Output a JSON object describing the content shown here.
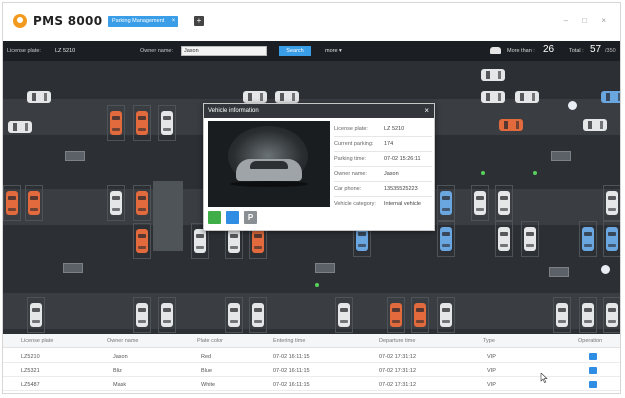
{
  "app": {
    "name": "PMS 8000"
  },
  "tabs": [
    {
      "label": "Parking Management",
      "close": "×"
    }
  ],
  "tab_add": "+",
  "window_controls": "– □ ×",
  "filter": {
    "plate_label": "License plate:",
    "plate_value": "LZ 5210",
    "owner_label": "Owner name:",
    "owner_value": "Jason",
    "search_label": "Search",
    "more_label": "more ▾",
    "more_than_label": "More than :",
    "more_than_value": "26",
    "total_label": "Total :",
    "total_value": "57",
    "total_capacity": "/350"
  },
  "popup": {
    "title": "Vehicle information",
    "close": "×",
    "fields": [
      {
        "label": "License plate:",
        "value": "LZ 5210"
      },
      {
        "label": "Current parking:",
        "value": "174"
      },
      {
        "label": "Parking time:",
        "value": "07-02  15:26:11"
      },
      {
        "label": "Owner name:",
        "value": "Jason"
      },
      {
        "label": "Car phone:",
        "value": "13535525223"
      },
      {
        "label": "Vehicle category:",
        "value": "Internal vehicle"
      }
    ],
    "buttons": [
      {
        "label": ""
      },
      {
        "label": ""
      },
      {
        "label": "P"
      }
    ]
  },
  "table": {
    "columns": [
      "License plate",
      "Owner name",
      "Plate color",
      "Entering time",
      "Departure time",
      "Type",
      "Operation"
    ],
    "rows": [
      [
        "LZ5210",
        "Jason",
        "Red",
        "07-02  16:11:15",
        "07-02  17:31:12",
        "VIP"
      ],
      [
        "LZ5321",
        "Bliz",
        "Blue",
        "07-02  16:11:15",
        "07-02  17:31:12",
        "VIP"
      ],
      [
        "LZ5487",
        "Mask",
        "White",
        "07-02  16:11:15",
        "07-02  17:31:12",
        "VIP"
      ]
    ]
  },
  "colors": {
    "accent": "#3a9de8",
    "toolbar": "#1b1e22",
    "map": "#2c3035",
    "car_red": "#e26a3c",
    "car_blue": "#6aa6e0",
    "car_white": "#e4e6e8",
    "logo": "#f29a1f"
  },
  "icons": {
    "logo": "pms-logo-icon",
    "car": "car-icon",
    "operation": "edit-icon",
    "camera": "camera-icon",
    "vehicle_image": "vehicle-image-icon",
    "document": "document-icon",
    "parking": "parking-icon",
    "cursor": "mouse-cursor-icon"
  }
}
